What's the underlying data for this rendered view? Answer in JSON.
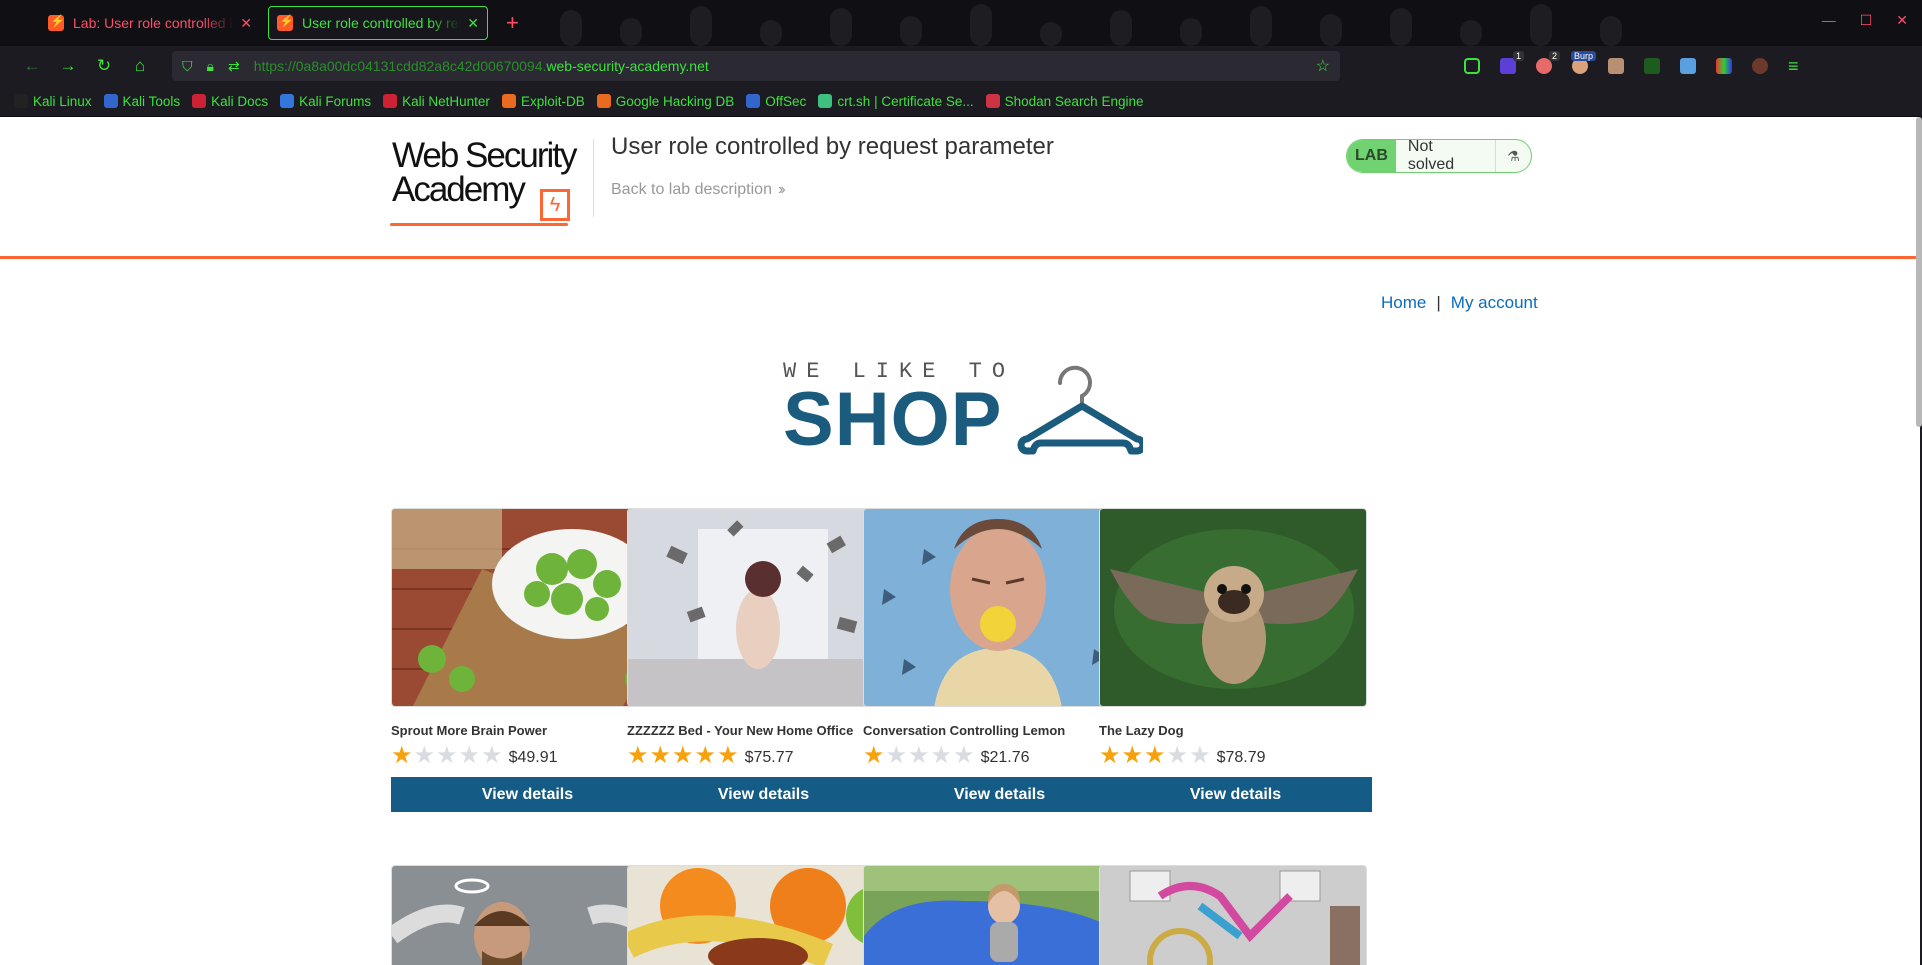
{
  "browser": {
    "tabs": [
      {
        "title": "Lab: User role controlled by request parameter",
        "active": false
      },
      {
        "title": "User role controlled by request parameter",
        "active": true
      }
    ],
    "url": {
      "dim": "https://0a8a00dc04131cdd82a8c42d00670094.",
      "host": "web-security-academy.net"
    },
    "bookmarks": [
      {
        "label": "Kali Linux",
        "color": "#222"
      },
      {
        "label": "Kali Tools",
        "color": "#3366cc"
      },
      {
        "label": "Kali Docs",
        "color": "#cc2233"
      },
      {
        "label": "Kali Forums",
        "color": "#3377dd"
      },
      {
        "label": "Kali NetHunter",
        "color": "#cc2233"
      },
      {
        "label": "Exploit-DB",
        "color": "#e86b20"
      },
      {
        "label": "Google Hacking DB",
        "color": "#e86b20"
      },
      {
        "label": "OffSec",
        "color": "#3366cc"
      },
      {
        "label": "crt.sh | Certificate Se...",
        "color": "#3fbf7f"
      },
      {
        "label": "Shodan Search Engine",
        "color": "#cc3344"
      }
    ],
    "extension_badges": {
      "second": "1",
      "third": "2",
      "burp": "Burp"
    }
  },
  "lab": {
    "logo_line1": "Web Security",
    "logo_line2": "Academy",
    "title": "User role controlled by request parameter",
    "back_link": "Back to lab description",
    "status_tag": "LAB",
    "status_text": "Not solved"
  },
  "nav": {
    "home": "Home",
    "separator": "|",
    "account": "My account"
  },
  "shop_logo": {
    "top": "WE LIKE TO",
    "main": "SHOP"
  },
  "products": [
    {
      "name": "Sprout More Brain Power",
      "rating": 1,
      "price": "$49.91",
      "button": "View details",
      "image": "brussels-sprouts"
    },
    {
      "name": "ZZZZZZ Bed - Your New Home Office",
      "rating": 5,
      "price": "$75.77",
      "button": "View details",
      "image": "flying-books"
    },
    {
      "name": "Conversation Controlling Lemon",
      "rating": 1,
      "price": "$21.76",
      "button": "View details",
      "image": "man-lemon"
    },
    {
      "name": "The Lazy Dog",
      "rating": 3,
      "price": "$78.79",
      "button": "View details",
      "image": "flying-pug"
    }
  ],
  "products_row2": [
    {
      "image": "angel-man"
    },
    {
      "image": "fruit"
    },
    {
      "image": "girl-beanbag"
    },
    {
      "image": "knitted-bike"
    }
  ],
  "colors": {
    "accent": "#ff6633",
    "button": "#145b86",
    "link": "#0a6cbf",
    "star": "#f7a20c"
  }
}
